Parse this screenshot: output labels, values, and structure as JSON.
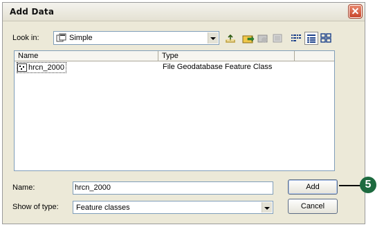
{
  "window": {
    "title": "Add Data"
  },
  "look_in": {
    "label": "Look in:",
    "value": "Simple"
  },
  "toolbar": {
    "buttons": [
      "up-one-level-icon",
      "connect-to-folder-icon",
      "disconnect-folder-icon",
      "delete-icon",
      "list-view-icon",
      "details-view-icon",
      "thumbnails-view-icon"
    ]
  },
  "list": {
    "columns": [
      "Name",
      "Type"
    ],
    "rows": [
      {
        "name": "hrcn_2000",
        "type": "File Geodatabase Feature Class"
      }
    ]
  },
  "name_field": {
    "label": "Name:",
    "value": "hrcn_2000"
  },
  "show_of_type": {
    "label": "Show of type:",
    "value": "Feature classes"
  },
  "buttons": {
    "add": "Add",
    "cancel": "Cancel"
  },
  "callout": {
    "number": "5",
    "color": "#1d6a3f"
  }
}
